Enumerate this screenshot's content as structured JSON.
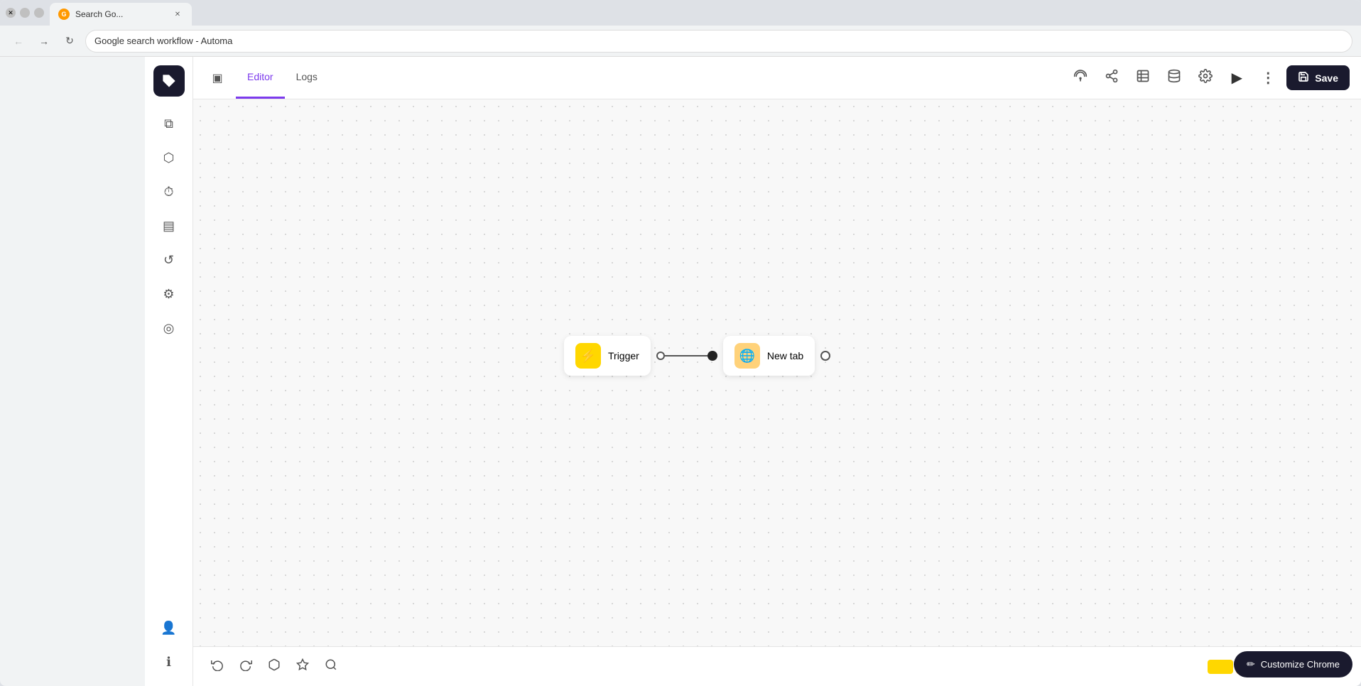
{
  "browser": {
    "tab_favicon": "G",
    "tab_title": "Search Go...",
    "app_title": "Google search workflow - Automa",
    "address_bar_text": "Google search workflow - Automa"
  },
  "header": {
    "editor_tab": "Editor",
    "logs_tab": "Logs",
    "save_label": "Save"
  },
  "sidebar": {
    "items": [
      {
        "name": "workflow-icon",
        "symbol": "⧉"
      },
      {
        "name": "blocks-icon",
        "symbol": "⬡"
      },
      {
        "name": "history-icon",
        "symbol": "⏱"
      },
      {
        "name": "notes-icon",
        "symbol": "▤"
      },
      {
        "name": "undo-history-icon",
        "symbol": "↺"
      },
      {
        "name": "settings-icon",
        "symbol": "⚙"
      },
      {
        "name": "location-icon",
        "symbol": "◎"
      }
    ],
    "bottom_items": [
      {
        "name": "profile-icon",
        "symbol": "👤"
      },
      {
        "name": "info-icon",
        "symbol": "ℹ"
      }
    ]
  },
  "toolbar_icons": [
    {
      "name": "broadcast-icon",
      "symbol": "📡"
    },
    {
      "name": "share-icon",
      "symbol": "⎇"
    },
    {
      "name": "table-icon",
      "symbol": "⊞"
    },
    {
      "name": "database-icon",
      "symbol": "🗄"
    },
    {
      "name": "settings2-icon",
      "symbol": "⚙"
    },
    {
      "name": "run-icon",
      "symbol": "▶"
    },
    {
      "name": "more-icon",
      "symbol": "⋮"
    }
  ],
  "workflow": {
    "trigger_label": "Trigger",
    "new_tab_label": "New tab"
  },
  "bottom_toolbar": {
    "undo_label": "↩",
    "redo_label": "↪",
    "blocks2_label": "⬡",
    "ai_label": "✦",
    "search_label": "🔍"
  },
  "zoom": {
    "fullscreen_symbol": "⛶",
    "zoom_out_symbol": "−",
    "zoom_in_symbol": "+"
  },
  "customize_chrome": {
    "label": "Customize Chrome",
    "icon": "✏"
  }
}
